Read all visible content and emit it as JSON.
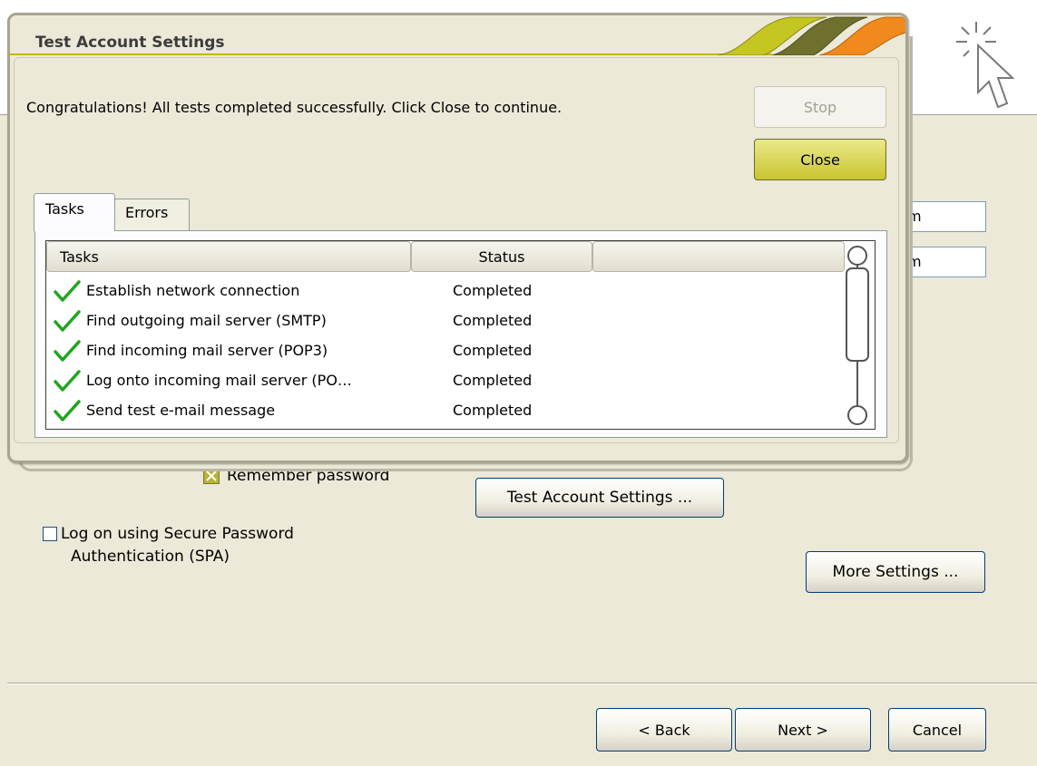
{
  "wizard": {
    "field_value_1": "m",
    "field_value_2": "m",
    "remember_password_label": "Remember password",
    "test_account_settings_button": "Test Account Settings ...",
    "spa_label_line1": "Log on using Secure Password",
    "spa_label_line2": "Authentication (SPA)",
    "more_settings_button": "More Settings ...",
    "back_button": "< Back",
    "next_button": "Next >",
    "cancel_button": "Cancel"
  },
  "dialog": {
    "title": "Test Account Settings",
    "message": "Congratulations! All tests completed successfully. Click Close to continue.",
    "stop_button": "Stop",
    "close_button": "Close",
    "tabs": [
      {
        "label": "Tasks",
        "selected": true
      },
      {
        "label": "Errors",
        "selected": false
      }
    ],
    "columns": [
      "Tasks",
      "Status",
      ""
    ],
    "rows": [
      {
        "task": "Establish network connection",
        "status": "Completed"
      },
      {
        "task": "Find outgoing mail server (SMTP)",
        "status": "Completed"
      },
      {
        "task": "Find incoming mail server (POP3)",
        "status": "Completed"
      },
      {
        "task": "Log onto incoming mail server (PO…",
        "status": "Completed"
      },
      {
        "task": "Send test e-mail message",
        "status": "Completed"
      }
    ]
  },
  "colors": {
    "accent_olive": "#b5b51a",
    "accent_dark_olive": "#6b6b2a",
    "accent_orange": "#f08a1c",
    "check_green": "#1fa51f"
  },
  "icons": [
    "cursor-click-icon",
    "checkmark-icon",
    "checkbox-checked-icon",
    "checkbox-empty-icon"
  ]
}
